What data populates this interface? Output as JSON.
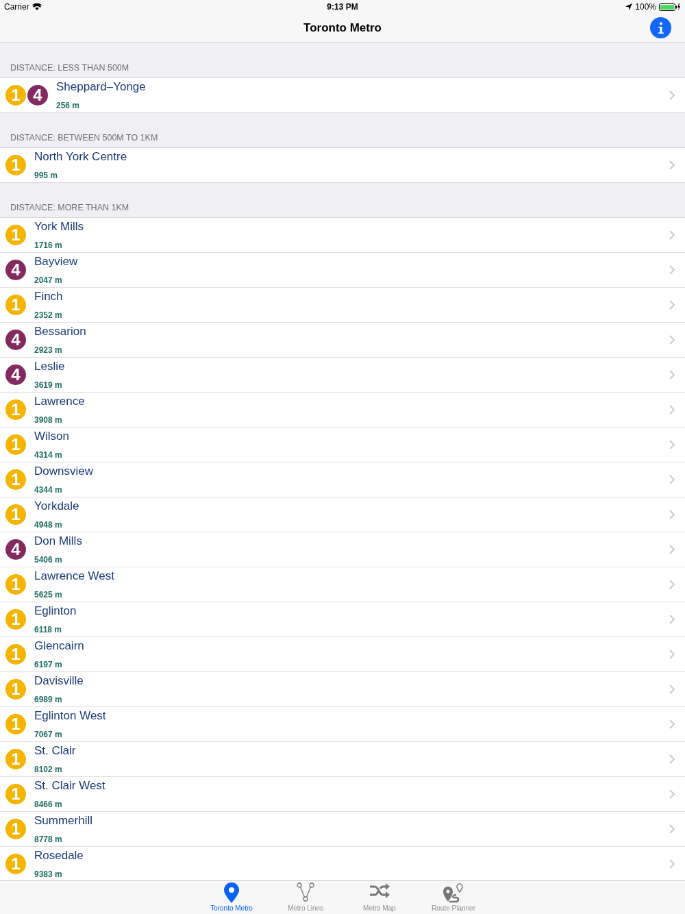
{
  "status_bar": {
    "carrier": "Carrier",
    "time": "9:13 PM",
    "battery": "100%"
  },
  "nav": {
    "title": "Toronto Metro"
  },
  "sections": [
    {
      "header": "DISTANCE: LESS THAN 500M",
      "rows": [
        {
          "lines": [
            {
              "label": "1",
              "color": "#f5b400"
            },
            {
              "label": "4",
              "color": "#832b61"
            }
          ],
          "name": "Sheppard–Yonge",
          "distance": "256 m"
        }
      ]
    },
    {
      "header": "DISTANCE: BETWEEN 500M TO 1KM",
      "rows": [
        {
          "lines": [
            {
              "label": "1",
              "color": "#f5b400"
            }
          ],
          "name": "North York Centre",
          "distance": "995 m"
        }
      ]
    },
    {
      "header": "DISTANCE: MORE THAN 1KM",
      "rows": [
        {
          "lines": [
            {
              "label": "1",
              "color": "#f5b400"
            }
          ],
          "name": "York Mills",
          "distance": "1716 m"
        },
        {
          "lines": [
            {
              "label": "4",
              "color": "#832b61"
            }
          ],
          "name": "Bayview",
          "distance": "2047 m"
        },
        {
          "lines": [
            {
              "label": "1",
              "color": "#f5b400"
            }
          ],
          "name": "Finch",
          "distance": "2352 m"
        },
        {
          "lines": [
            {
              "label": "4",
              "color": "#832b61"
            }
          ],
          "name": "Bessarion",
          "distance": "2923 m"
        },
        {
          "lines": [
            {
              "label": "4",
              "color": "#832b61"
            }
          ],
          "name": "Leslie",
          "distance": "3619 m"
        },
        {
          "lines": [
            {
              "label": "1",
              "color": "#f5b400"
            }
          ],
          "name": "Lawrence",
          "distance": "3908 m"
        },
        {
          "lines": [
            {
              "label": "1",
              "color": "#f5b400"
            }
          ],
          "name": "Wilson",
          "distance": "4314 m"
        },
        {
          "lines": [
            {
              "label": "1",
              "color": "#f5b400"
            }
          ],
          "name": "Downsview",
          "distance": "4344 m"
        },
        {
          "lines": [
            {
              "label": "1",
              "color": "#f5b400"
            }
          ],
          "name": "Yorkdale",
          "distance": "4948 m"
        },
        {
          "lines": [
            {
              "label": "4",
              "color": "#832b61"
            }
          ],
          "name": "Don Mills",
          "distance": "5406 m"
        },
        {
          "lines": [
            {
              "label": "1",
              "color": "#f5b400"
            }
          ],
          "name": "Lawrence West",
          "distance": "5625 m"
        },
        {
          "lines": [
            {
              "label": "1",
              "color": "#f5b400"
            }
          ],
          "name": "Eglinton",
          "distance": "6118 m"
        },
        {
          "lines": [
            {
              "label": "1",
              "color": "#f5b400"
            }
          ],
          "name": "Glencairn",
          "distance": "6197 m"
        },
        {
          "lines": [
            {
              "label": "1",
              "color": "#f5b400"
            }
          ],
          "name": "Davisville",
          "distance": "6989 m"
        },
        {
          "lines": [
            {
              "label": "1",
              "color": "#f5b400"
            }
          ],
          "name": "Eglinton West",
          "distance": "7067 m"
        },
        {
          "lines": [
            {
              "label": "1",
              "color": "#f5b400"
            }
          ],
          "name": "St. Clair",
          "distance": "8102 m"
        },
        {
          "lines": [
            {
              "label": "1",
              "color": "#f5b400"
            }
          ],
          "name": "St. Clair West",
          "distance": "8466 m"
        },
        {
          "lines": [
            {
              "label": "1",
              "color": "#f5b400"
            }
          ],
          "name": "Summerhill",
          "distance": "8778 m"
        },
        {
          "lines": [
            {
              "label": "1",
              "color": "#f5b400"
            }
          ],
          "name": "Rosedale",
          "distance": "9383 m"
        }
      ]
    }
  ],
  "tab_bar": [
    {
      "kind": "pin",
      "label": "Toronto Metro",
      "selected": true
    },
    {
      "kind": "lines",
      "label": "Metro Lines",
      "selected": false
    },
    {
      "kind": "shuffle",
      "label": "Metro Map",
      "selected": false
    },
    {
      "kind": "route",
      "label": "Route Planner",
      "selected": false
    }
  ]
}
